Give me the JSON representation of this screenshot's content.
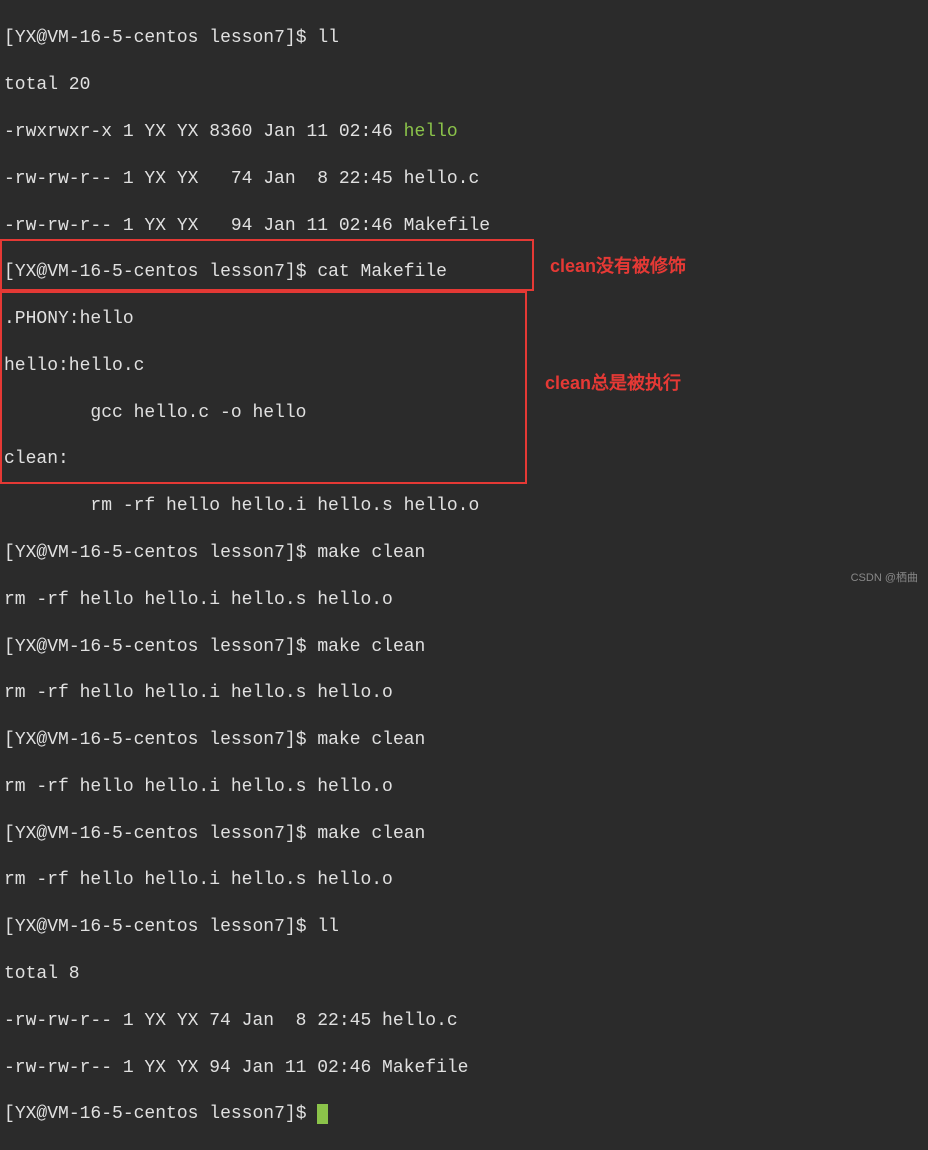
{
  "prompt": {
    "open": "[",
    "userhost": "YX@VM-16-5-centos",
    "dir": "lesson7",
    "close": "]",
    "symbol": "$"
  },
  "commands": {
    "ll1": "ll",
    "cat": "cat Makefile",
    "makeclean": "make clean",
    "ll2": "ll"
  },
  "listing1": {
    "total": "total 20",
    "line1a": "-rwxrwxr-x 1 YX YX 8360 Jan 11 02:46 ",
    "line1b": "hello",
    "line2": "-rw-rw-r-- 1 YX YX   74 Jan  8 22:45 hello.c",
    "line3": "-rw-rw-r-- 1 YX YX   94 Jan 11 02:46 Makefile"
  },
  "makefile": {
    "l1": ".PHONY:hello",
    "l2": "hello:hello.c",
    "l3": "        gcc hello.c -o hello",
    "l4": "clean:",
    "l5": "        rm -rf hello hello.i hello.s hello.o"
  },
  "rmoutput": "rm -rf hello hello.i hello.s hello.o",
  "listing2": {
    "total": "total 8",
    "line1": "-rw-rw-r-- 1 YX YX 74 Jan  8 22:45 hello.c",
    "line2": "-rw-rw-r-- 1 YX YX 94 Jan 11 02:46 Makefile"
  },
  "annotations": {
    "a1": "clean没有被修饰",
    "a2": "clean总是被执行"
  },
  "watermark": "CSDN @栖曲"
}
